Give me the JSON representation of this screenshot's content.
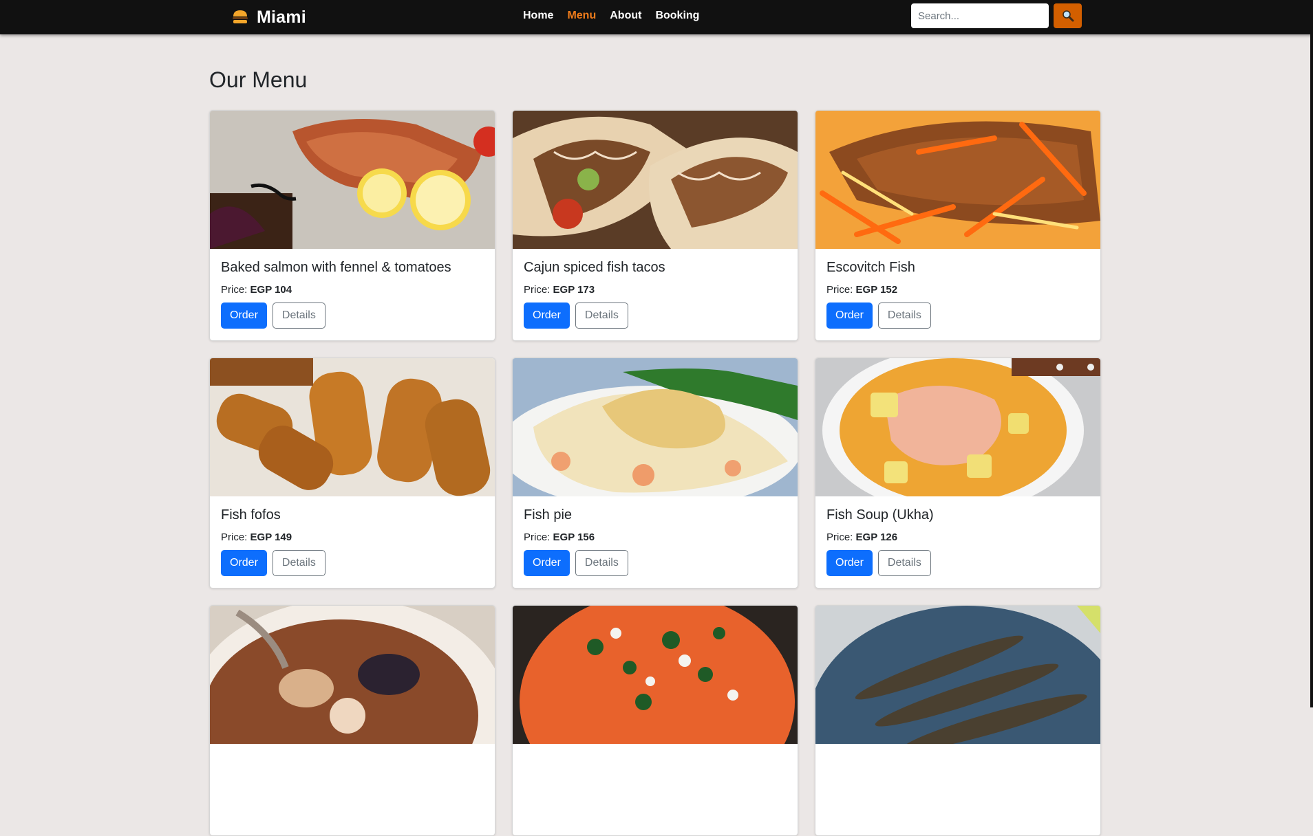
{
  "navbar": {
    "brand": "Miami",
    "links": [
      {
        "label": "Home",
        "active": false
      },
      {
        "label": "Menu",
        "active": true
      },
      {
        "label": "About",
        "active": false
      },
      {
        "label": "Booking",
        "active": false
      }
    ],
    "search_placeholder": "Search...",
    "search_icon": "magnifier-icon",
    "brand_icon": "burger-icon",
    "accent_color": "#f07c1b"
  },
  "page": {
    "title": "Our Menu",
    "price_label": "Price:",
    "order_label": "Order",
    "details_label": "Details"
  },
  "menu": [
    {
      "name": "Baked salmon with fennel & tomatoes",
      "price": "EGP 104",
      "image": "salmon-photo"
    },
    {
      "name": "Cajun spiced fish tacos",
      "price": "EGP 173",
      "image": "tacos-photo"
    },
    {
      "name": "Escovitch Fish",
      "price": "EGP 152",
      "image": "escovitch-photo"
    },
    {
      "name": "Fish fofos",
      "price": "EGP 149",
      "image": "fofos-photo"
    },
    {
      "name": "Fish pie",
      "price": "EGP 156",
      "image": "fish-pie-photo"
    },
    {
      "name": "Fish Soup (Ukha)",
      "price": "EGP 126",
      "image": "fish-soup-photo"
    },
    {
      "name": "",
      "price": "",
      "image": "seafood-stew-photo"
    },
    {
      "name": "",
      "price": "",
      "image": "tomato-bake-photo"
    },
    {
      "name": "",
      "price": "",
      "image": "grilled-sardines-photo"
    }
  ]
}
